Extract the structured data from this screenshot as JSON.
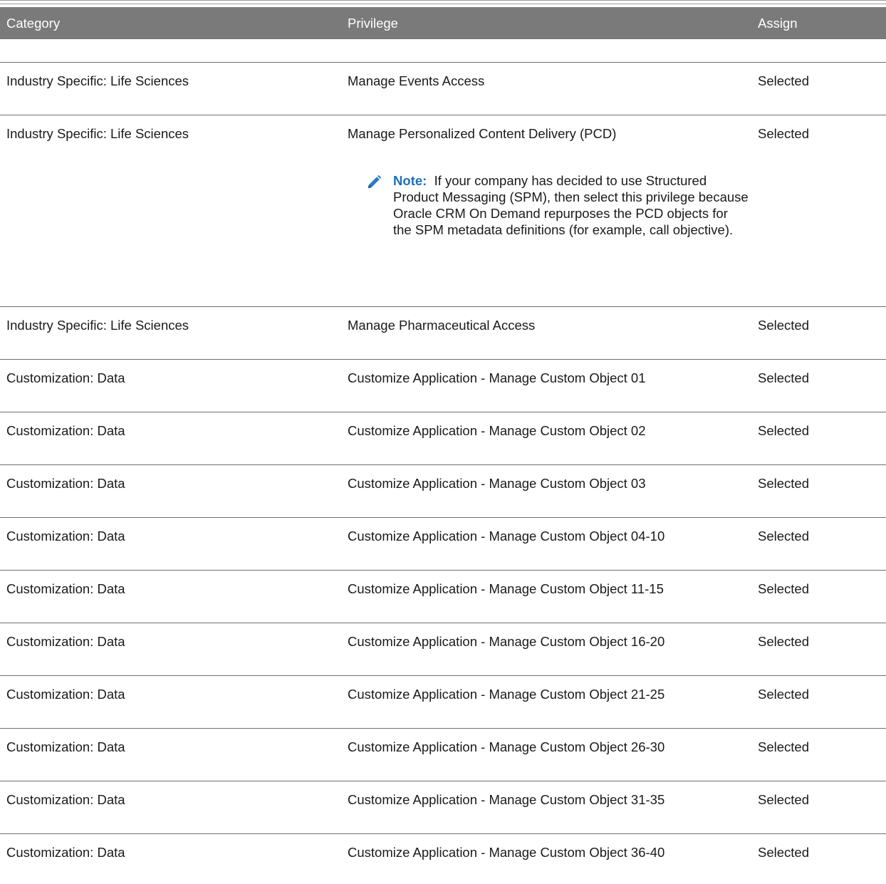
{
  "header": {
    "category": "Category",
    "privilege": "Privilege",
    "assign": "Assign"
  },
  "rows": [
    {
      "category": "Industry Specific: Life Sciences",
      "privilege": "Manage Events Access",
      "assign": "Selected"
    },
    {
      "category": "Industry Specific: Life Sciences",
      "privilege": "Manage Personalized Content Delivery (PCD)",
      "assign": "Selected",
      "note": {
        "label": "Note:",
        "text": "If your company has decided to use Structured Product Messaging (SPM), then select this privilege because Oracle CRM On Demand repurposes the PCD objects for the SPM metadata definitions (for example, call objective)."
      }
    },
    {
      "category": "Industry Specific: Life Sciences",
      "privilege": "Manage Pharmaceutical Access",
      "assign": "Selected"
    },
    {
      "category": "Customization: Data",
      "privilege": "Customize Application - Manage Custom Object 01",
      "assign": "Selected"
    },
    {
      "category": "Customization: Data",
      "privilege": "Customize Application - Manage Custom Object 02",
      "assign": "Selected"
    },
    {
      "category": "Customization: Data",
      "privilege": "Customize Application - Manage Custom Object 03",
      "assign": "Selected"
    },
    {
      "category": "Customization: Data",
      "privilege": "Customize Application - Manage Custom Object 04-10",
      "assign": "Selected"
    },
    {
      "category": "Customization: Data",
      "privilege": "Customize Application - Manage Custom Object 11-15",
      "assign": "Selected"
    },
    {
      "category": "Customization: Data",
      "privilege": "Customize Application - Manage Custom Object 16-20",
      "assign": "Selected"
    },
    {
      "category": "Customization: Data",
      "privilege": "Customize Application - Manage Custom Object 21-25",
      "assign": "Selected"
    },
    {
      "category": "Customization: Data",
      "privilege": "Customize Application - Manage Custom Object 26-30",
      "assign": "Selected"
    },
    {
      "category": "Customization: Data",
      "privilege": "Customize Application - Manage Custom Object 31-35",
      "assign": "Selected"
    },
    {
      "category": "Customization: Data",
      "privilege": "Customize Application - Manage Custom Object 36-40",
      "assign": "Selected"
    }
  ],
  "icons": {
    "note": "pencil-icon"
  },
  "colors": {
    "header_bg": "#7a7a7a",
    "note_label": "#1f6fb8",
    "pencil": "#2a7bc4"
  }
}
